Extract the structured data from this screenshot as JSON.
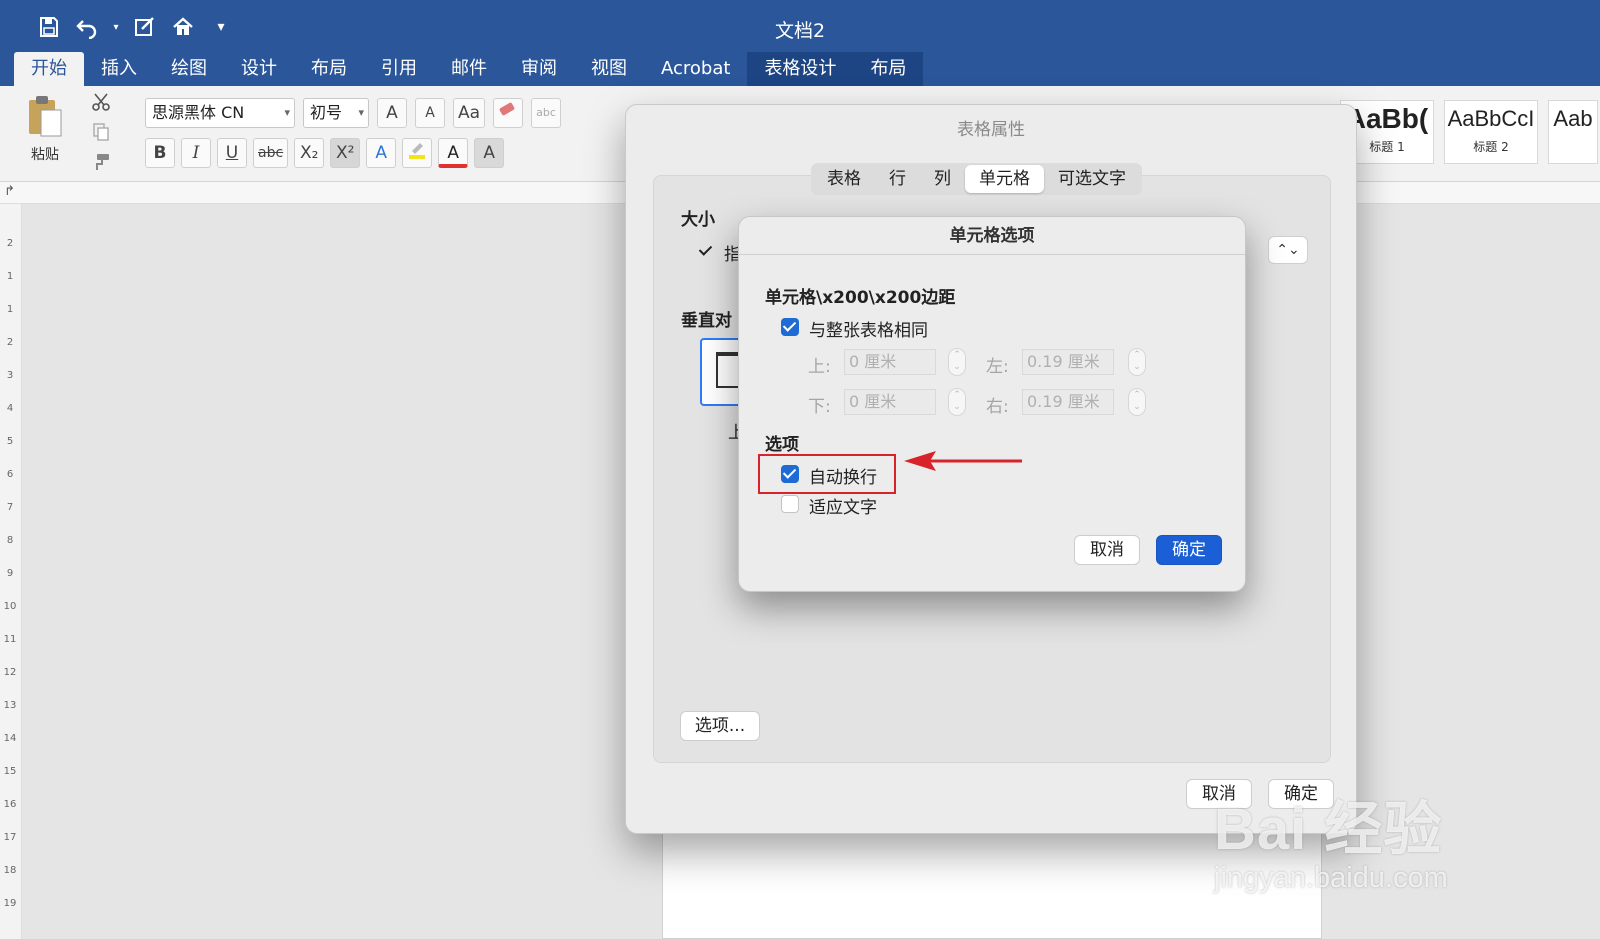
{
  "window": {
    "title": "文档2"
  },
  "quick_access": [
    "save-icon",
    "undo-icon",
    "edit-doc-icon",
    "home-icon",
    "customize-icon"
  ],
  "tabs": [
    {
      "label": "开始",
      "state": "active"
    },
    {
      "label": "插入"
    },
    {
      "label": "绘图"
    },
    {
      "label": "设计"
    },
    {
      "label": "布局"
    },
    {
      "label": "引用"
    },
    {
      "label": "邮件"
    },
    {
      "label": "审阅"
    },
    {
      "label": "视图"
    },
    {
      "label": "Acrobat"
    },
    {
      "label": "表格设计",
      "state": "contextual"
    },
    {
      "label": "布局",
      "state": "contextual"
    }
  ],
  "ribbon": {
    "paste_label": "粘贴",
    "font_name": "思源黑体 CN",
    "font_size": "初号",
    "grow_font": "A",
    "shrink_font": "A",
    "change_case": "Aa",
    "bold": "B",
    "italic": "I",
    "underline": "U",
    "strikethrough": "abc",
    "subscript": "X₂",
    "superscript": "X²",
    "text_effects": "A",
    "font_color": "A",
    "char_shading": "A",
    "styles": [
      {
        "preview": "AaBb(",
        "name": "标题 1"
      },
      {
        "preview": "AaBbCcI",
        "name": "标题 2"
      },
      {
        "preview": "Aab",
        "name": ""
      }
    ]
  },
  "ruler": {
    "vertical_numbers": [
      "2",
      "1",
      "1",
      "2",
      "3",
      "4",
      "5",
      "6",
      "7",
      "8",
      "9",
      "10",
      "11",
      "12",
      "13",
      "14",
      "15",
      "16",
      "17",
      "18",
      "19"
    ]
  },
  "table_properties": {
    "title": "表格属性",
    "tabs": [
      "表格",
      "行",
      "列",
      "单元格",
      "可选文字"
    ],
    "active_tab": "单元格",
    "size_label": "大小",
    "size_check_label": "指",
    "valign_label": "垂直对",
    "valign_option_label": "上",
    "options_button": "选项...",
    "cancel": "取消",
    "ok": "确定"
  },
  "cell_options": {
    "title": "单元格选项",
    "margins_label": "单元格\\x200\\x200边距",
    "same_as_table": {
      "label": "与整张表格相同",
      "checked": true
    },
    "top": {
      "label": "上:",
      "value": "0 厘米"
    },
    "bottom": {
      "label": "下:",
      "value": "0 厘米"
    },
    "left": {
      "label": "左:",
      "value": "0.19 厘米"
    },
    "right": {
      "label": "右:",
      "value": "0.19 厘米"
    },
    "options_label": "选项",
    "wrap_text": {
      "label": "自动换行",
      "checked": true
    },
    "fit_text": {
      "label": "适应文字",
      "checked": false
    },
    "cancel": "取消",
    "ok": "确定"
  },
  "watermark": {
    "brand": "Bai 经验",
    "url": "jingyan.baidu.com"
  },
  "colors": {
    "ribbon_blue": "#2b579a",
    "accent_blue": "#1f6bd6",
    "highlight_red": "#d8232a"
  }
}
